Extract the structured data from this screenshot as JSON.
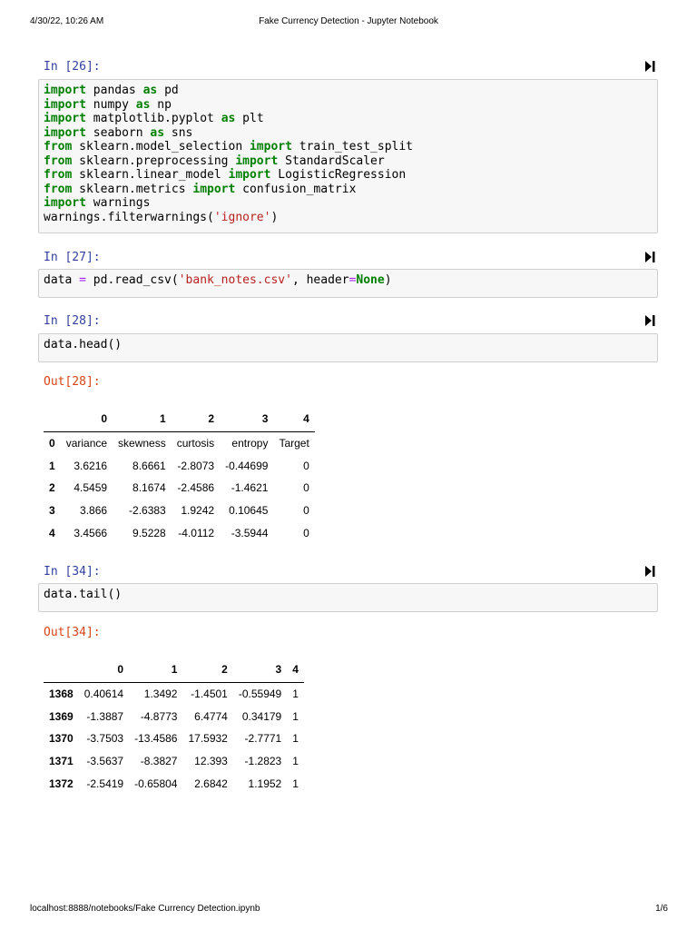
{
  "page_header": {
    "datetime": "4/30/22, 10:26 AM",
    "title": "Fake Currency Detection - Jupyter Notebook"
  },
  "page_footer": {
    "url": "localhost:8888/notebooks/Fake Currency Detection.ipynb",
    "page": "1/6"
  },
  "cells": [
    {
      "prompt": "In [26]:",
      "code": [
        [
          [
            "kw",
            "import"
          ],
          [
            "t",
            " pandas "
          ],
          [
            "kw",
            "as"
          ],
          [
            "t",
            " pd"
          ]
        ],
        [
          [
            "kw",
            "import"
          ],
          [
            "t",
            " numpy "
          ],
          [
            "kw",
            "as"
          ],
          [
            "t",
            " np"
          ]
        ],
        [
          [
            "kw",
            "import"
          ],
          [
            "t",
            " matplotlib.pyplot "
          ],
          [
            "kw",
            "as"
          ],
          [
            "t",
            " plt"
          ]
        ],
        [
          [
            "kw",
            "import"
          ],
          [
            "t",
            " seaborn "
          ],
          [
            "kw",
            "as"
          ],
          [
            "t",
            " sns"
          ]
        ],
        [
          [
            "kw",
            "from"
          ],
          [
            "t",
            " sklearn.model_selection "
          ],
          [
            "kw",
            "import"
          ],
          [
            "t",
            " train_test_split"
          ]
        ],
        [
          [
            "kw",
            "from"
          ],
          [
            "t",
            " sklearn.preprocessing "
          ],
          [
            "kw",
            "import"
          ],
          [
            "t",
            " StandardScaler"
          ]
        ],
        [
          [
            "kw",
            "from"
          ],
          [
            "t",
            " sklearn.linear_model "
          ],
          [
            "kw",
            "import"
          ],
          [
            "t",
            " LogisticRegression"
          ]
        ],
        [
          [
            "kw",
            "from"
          ],
          [
            "t",
            " sklearn.metrics "
          ],
          [
            "kw",
            "import"
          ],
          [
            "t",
            " confusion_matrix"
          ]
        ],
        [
          [
            "kw",
            "import"
          ],
          [
            "t",
            " warnings"
          ]
        ],
        [
          [
            "t",
            "warnings.filterwarnings("
          ],
          [
            "str",
            "'ignore'"
          ],
          [
            "t",
            ")"
          ]
        ]
      ]
    },
    {
      "prompt": "In [27]:",
      "code": [
        [
          [
            "t",
            "data "
          ],
          [
            "op",
            "="
          ],
          [
            "t",
            " pd.read_csv("
          ],
          [
            "str",
            "'bank_notes.csv'"
          ],
          [
            "t",
            ", header"
          ],
          [
            "op",
            "="
          ],
          [
            "const",
            "None"
          ],
          [
            "t",
            ")"
          ]
        ]
      ]
    },
    {
      "prompt": "In [28]:",
      "code": [
        [
          [
            "t",
            "data.head()"
          ]
        ]
      ]
    },
    {
      "prompt": "In [34]:",
      "code": [
        [
          [
            "t",
            "data.tail()"
          ]
        ]
      ]
    }
  ],
  "outputs": [
    {
      "prompt": "Out[28]:",
      "columns": [
        "",
        "0",
        "1",
        "2",
        "3",
        "4"
      ],
      "rows": [
        [
          "0",
          "variance",
          "skewness",
          "curtosis",
          "entropy",
          "Target"
        ],
        [
          "1",
          "3.6216",
          "8.6661",
          "-2.8073",
          "-0.44699",
          "0"
        ],
        [
          "2",
          "4.5459",
          "8.1674",
          "-2.4586",
          "-1.4621",
          "0"
        ],
        [
          "3",
          "3.866",
          "-2.6383",
          "1.9242",
          "0.10645",
          "0"
        ],
        [
          "4",
          "3.4566",
          "9.5228",
          "-4.0112",
          "-3.5944",
          "0"
        ]
      ]
    },
    {
      "prompt": "Out[34]:",
      "columns": [
        "",
        "0",
        "1",
        "2",
        "3",
        "4"
      ],
      "rows": [
        [
          "1368",
          "0.40614",
          "1.3492",
          "-1.4501",
          "-0.55949",
          "1"
        ],
        [
          "1369",
          "-1.3887",
          "-4.8773",
          "6.4774",
          "0.34179",
          "1"
        ],
        [
          "1370",
          "-3.7503",
          "-13.4586",
          "17.5932",
          "-2.7771",
          "1"
        ],
        [
          "1371",
          "-3.5637",
          "-8.3827",
          "12.393",
          "-1.2823",
          "1"
        ],
        [
          "1372",
          "-2.5419",
          "-0.65804",
          "2.6842",
          "1.1952",
          "1"
        ]
      ]
    }
  ],
  "icons": {
    "run": "step-forward-icon"
  }
}
